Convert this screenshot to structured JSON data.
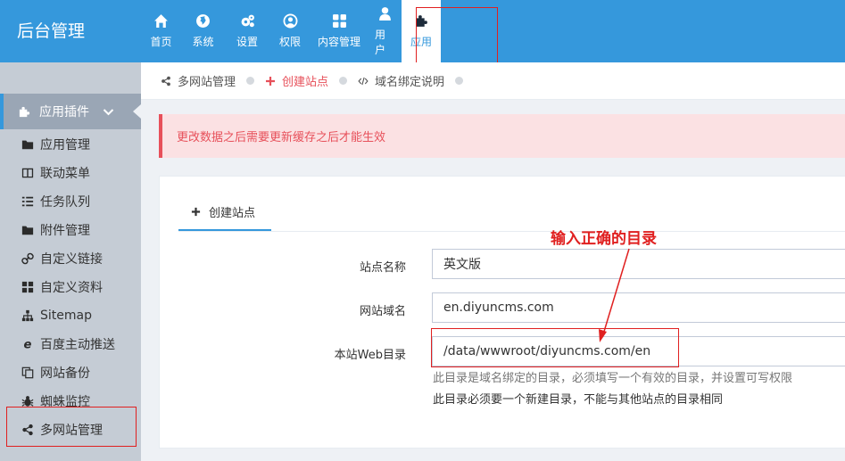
{
  "brand": "后台管理",
  "topnav": [
    {
      "label": "首页",
      "icon": "home-icon"
    },
    {
      "label": "系统",
      "icon": "globe-icon"
    },
    {
      "label": "设置",
      "icon": "gears-icon"
    },
    {
      "label": "权限",
      "icon": "user-circle-icon"
    },
    {
      "label": "内容管理",
      "icon": "grid-icon"
    },
    {
      "label": "用户",
      "icon": "user-icon"
    },
    {
      "label": "应用",
      "icon": "puzzle-icon",
      "active": true
    }
  ],
  "sidebar": {
    "section": "应用插件",
    "items": [
      {
        "label": "应用管理",
        "icon": "folder-icon"
      },
      {
        "label": "联动菜单",
        "icon": "columns-icon"
      },
      {
        "label": "任务队列",
        "icon": "list-icon"
      },
      {
        "label": "附件管理",
        "icon": "folder-icon"
      },
      {
        "label": "自定义链接",
        "icon": "link-icon"
      },
      {
        "label": "自定义资料",
        "icon": "th-icon"
      },
      {
        "label": "Sitemap",
        "icon": "sitemap-icon"
      },
      {
        "label": "百度主动推送",
        "icon": "ie-icon"
      },
      {
        "label": "网站备份",
        "icon": "copy-icon"
      },
      {
        "label": "蜘蛛监控",
        "icon": "bug-icon"
      },
      {
        "label": "多网站管理",
        "icon": "share-icon"
      }
    ]
  },
  "breadcrumb": [
    {
      "label": "多网站管理",
      "icon": "share-icon"
    },
    {
      "label": "创建站点",
      "icon": "plus-icon",
      "color": "#e7505a"
    },
    {
      "label": "域名绑定说明",
      "icon": "code-icon"
    }
  ],
  "alert": "更改数据之后需要更新缓存之后才能生效",
  "tab": {
    "label": "创建站点"
  },
  "form": {
    "site_name": {
      "label": "站点名称",
      "value": "英文版"
    },
    "domain": {
      "label": "网站域名",
      "value": "en.diyuncms.com"
    },
    "webdir": {
      "label": "本站Web目录",
      "value": "/data/wwwroot/diyuncms.com/en"
    },
    "help1": "此目录是域名绑定的目录，必须填写一个有效的目录，并设置可写权限",
    "help2": "此目录必须要一个新建目录，不能与其他站点的目录相同"
  },
  "annotation": "输入正确的目录",
  "colors": {
    "primary": "#3598dc",
    "danger": "#e7505a",
    "highlight": "#e02020"
  }
}
